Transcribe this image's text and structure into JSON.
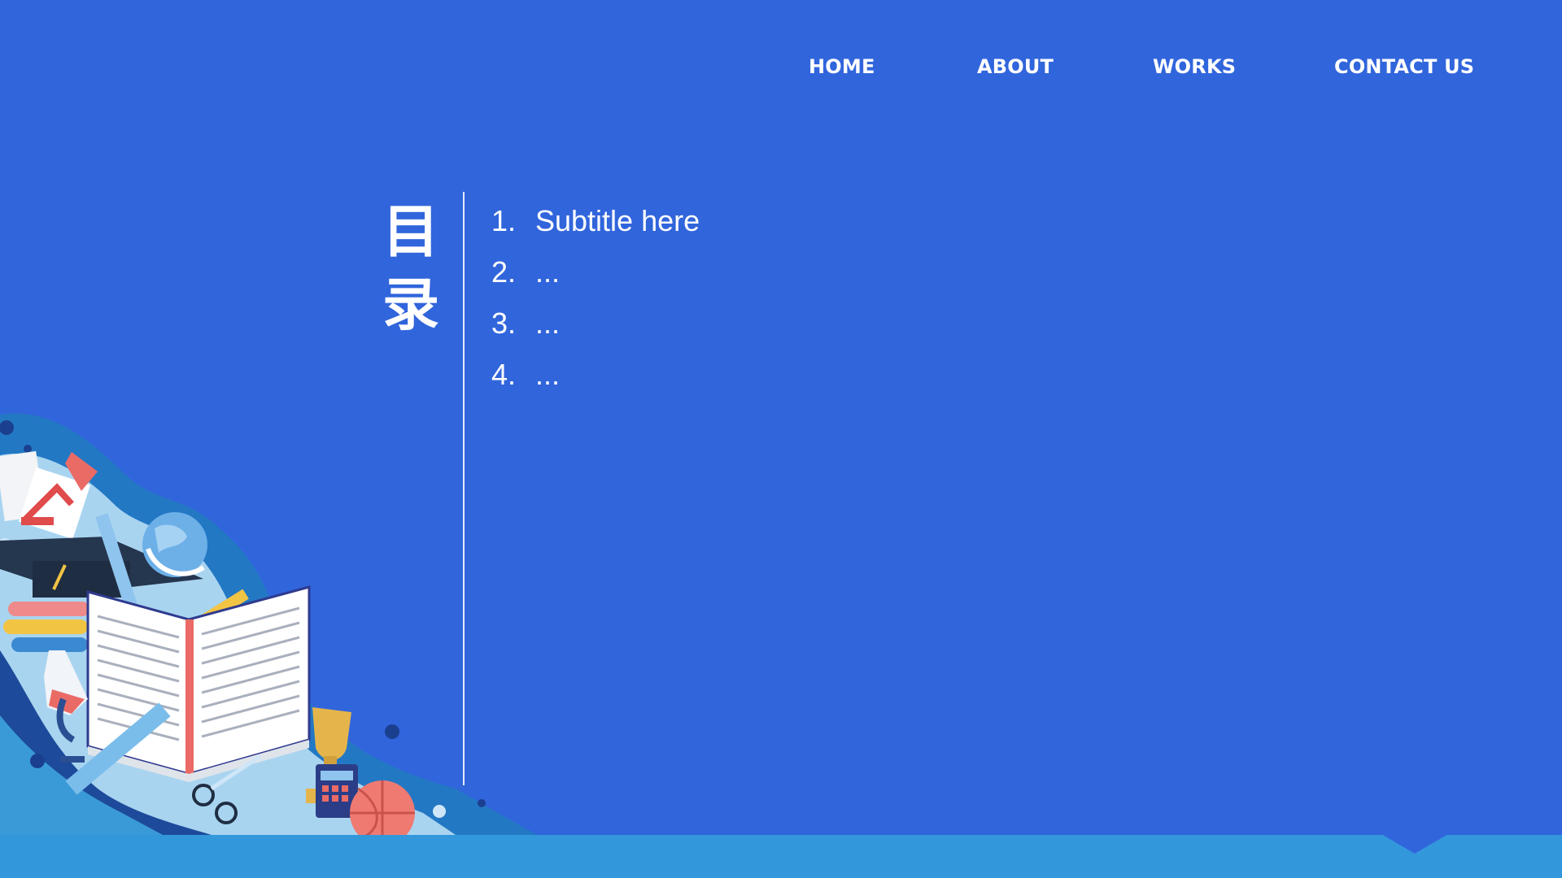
{
  "nav": {
    "items": [
      {
        "label": "HOME"
      },
      {
        "label": "ABOUT"
      },
      {
        "label": "WORKS"
      },
      {
        "label": "CONTACT US"
      }
    ]
  },
  "toc": {
    "title": "目录",
    "items": [
      {
        "num": "1.",
        "text": "Subtitle here"
      },
      {
        "num": "2.",
        "text": "..."
      },
      {
        "num": "3.",
        "text": "..."
      },
      {
        "num": "4.",
        "text": "..."
      }
    ]
  },
  "colors": {
    "background": "#3165dc",
    "footer": "#3398db",
    "text": "#ffffff"
  },
  "illustration": {
    "icons": [
      "open-book-icon",
      "graduation-cap-icon",
      "desk-lamp-icon",
      "globe-icon",
      "pencil-icon",
      "ruler-icon",
      "trophy-icon",
      "calculator-icon",
      "basketball-icon",
      "microscope-icon",
      "flask-icon",
      "scissors-icon",
      "books-stack-icon"
    ]
  }
}
